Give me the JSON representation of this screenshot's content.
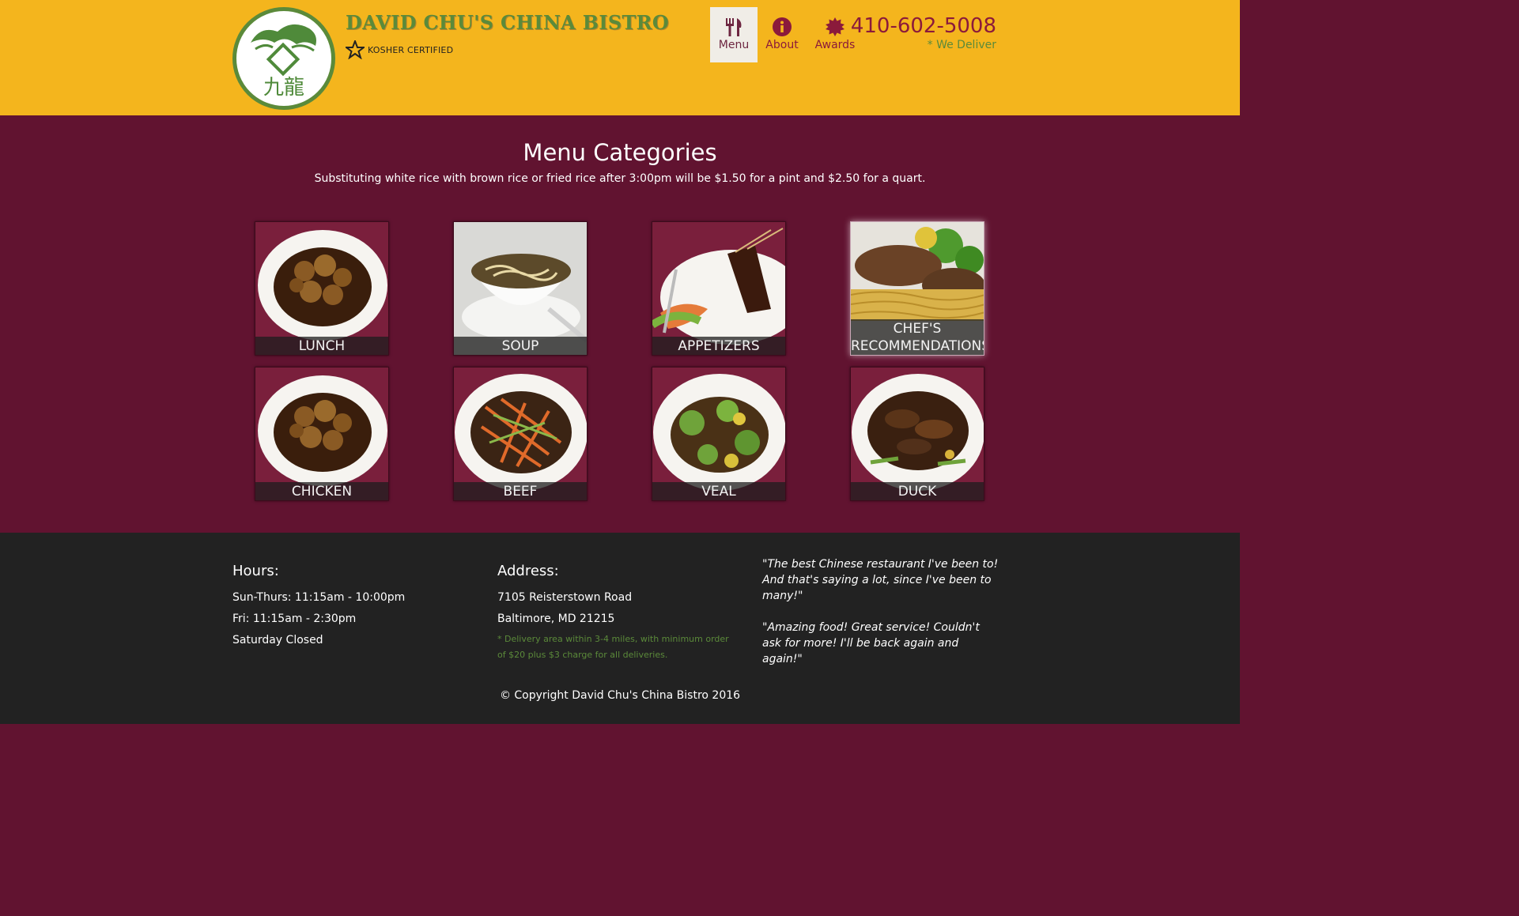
{
  "brand": {
    "title": "DAVID CHU'S CHINA BISTRO",
    "kosher": "KOSHER CERTIFIED",
    "logo_chars": "九龍"
  },
  "nav": {
    "items": [
      {
        "label": "Menu",
        "icon": "fork-knife-icon",
        "active": true
      },
      {
        "label": "About",
        "icon": "info-icon",
        "active": false
      },
      {
        "label": "Awards",
        "icon": "award-seal-icon",
        "active": false
      }
    ],
    "phone": "410-602-5008",
    "deliver": "* We Deliver"
  },
  "menu": {
    "title": "Menu Categories",
    "subtitle": "Substituting white rice with brown rice or fried rice after 3:00pm will be $1.50 for a pint and $2.50 for a quart.",
    "tiles": [
      {
        "label": "LUNCH",
        "dish": "orange-chicken"
      },
      {
        "label": "SOUP",
        "dish": "noodle-soup"
      },
      {
        "label": "APPETIZERS",
        "dish": "beef-skewers"
      },
      {
        "label": "CHEF'S RECOMMENDATIONS",
        "dish": "steak-noodles"
      },
      {
        "label": "CHICKEN",
        "dish": "orange-chicken"
      },
      {
        "label": "BEEF",
        "dish": "shredded-beef"
      },
      {
        "label": "VEAL",
        "dish": "veal-broccoli"
      },
      {
        "label": "DUCK",
        "dish": "duck-mushroom"
      }
    ]
  },
  "footer": {
    "hours": {
      "title": "Hours:",
      "lines": [
        "Sun-Thurs: 11:15am - 10:00pm",
        "Fri: 11:15am - 2:30pm",
        "Saturday Closed"
      ]
    },
    "address": {
      "title": "Address:",
      "lines": [
        "7105 Reisterstown Road",
        "Baltimore, MD 21215"
      ],
      "note": "* Delivery area within 3-4 miles, with minimum order of $20 plus $3 charge for all deliveries."
    },
    "quotes": [
      "\"The best Chinese restaurant I've been to! And that's saying a lot, since I've been to many!\"",
      "\"Amazing food! Great service! Couldn't ask for more! I'll be back again and again!\""
    ],
    "copyright": "© Copyright David Chu's China Bistro 2016"
  },
  "colors": {
    "header_bg": "#f4b51d",
    "main_bg": "#611330",
    "footer_bg": "#222222",
    "brand_green": "#5b8a3a",
    "accent_maroon": "#8b1a3b"
  }
}
